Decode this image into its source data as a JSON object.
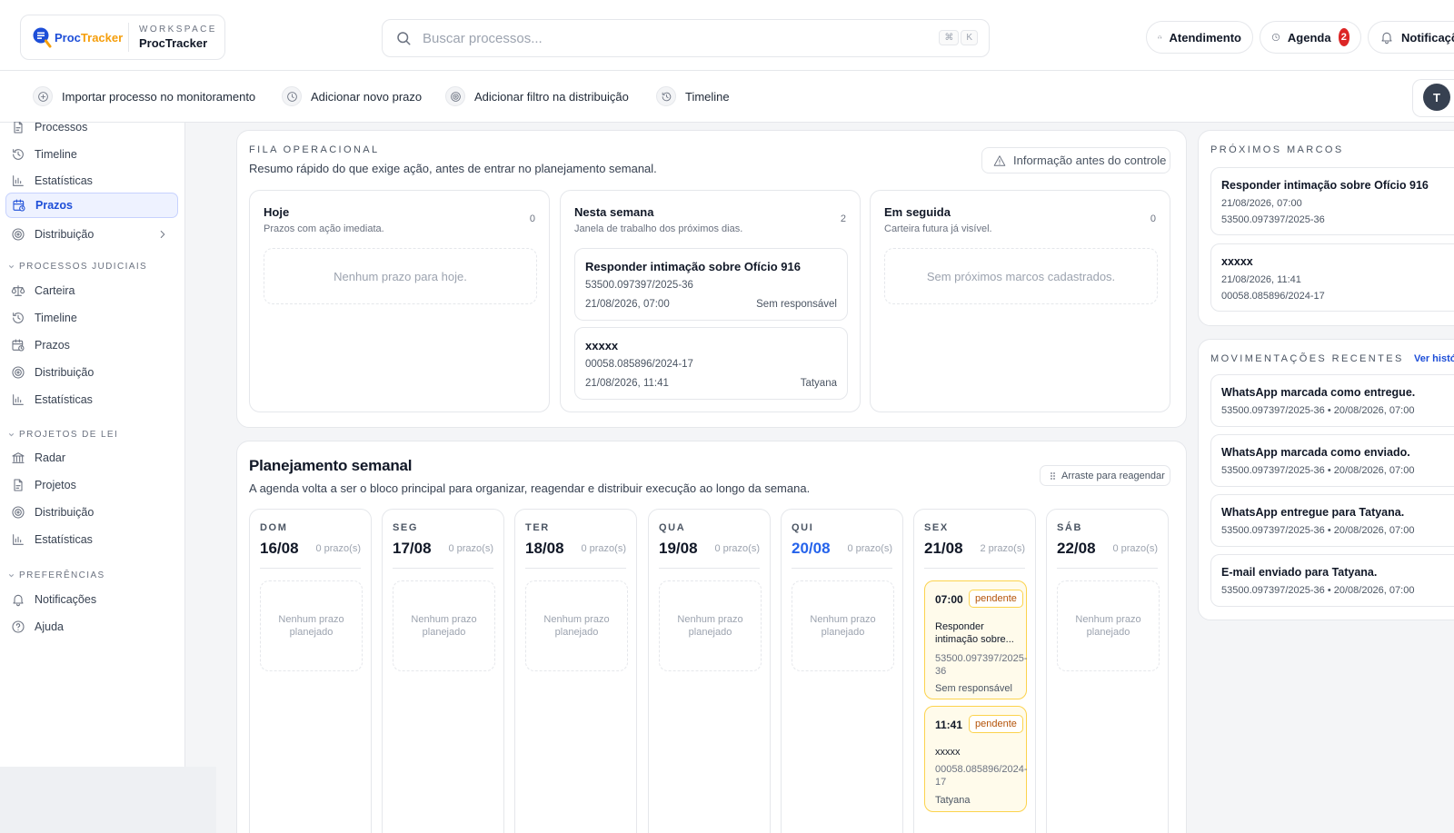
{
  "brand": {
    "logo_text_a": "Proc",
    "logo_text_b": "Tracker",
    "workspace_label": "WORKSPACE",
    "workspace_name": "ProcTracker"
  },
  "search": {
    "placeholder": "Buscar processos...",
    "shortcut_mod": "⌘",
    "shortcut_key": "K"
  },
  "header": {
    "atendimento_label": "Atendimento",
    "agenda_label": "Agenda",
    "agenda_badge": "2",
    "notificacoes_label": "Notificações",
    "avatar_initial": "T"
  },
  "quick_actions": [
    {
      "label": "Importar processo no monitoramento",
      "icon": "plus-circle-icon"
    },
    {
      "label": "Adicionar novo prazo",
      "icon": "clock-icon"
    },
    {
      "label": "Adicionar filtro na distribuição",
      "icon": "target-icon"
    },
    {
      "label": "Timeline",
      "icon": "history-icon"
    }
  ],
  "sidebar": {
    "top_items": [
      {
        "label": "Processos",
        "icon": "file-icon"
      },
      {
        "label": "Timeline",
        "icon": "history-icon"
      },
      {
        "label": "Estatísticas",
        "icon": "chart-icon"
      },
      {
        "label": "Prazos",
        "icon": "calendar-clock-icon",
        "active": true
      },
      {
        "label": "Distribuição",
        "icon": "target-icon"
      }
    ],
    "sections": [
      {
        "title": "PROCESSOS JUDICIAIS",
        "items": [
          {
            "label": "Carteira",
            "icon": "scale-icon"
          },
          {
            "label": "Timeline",
            "icon": "history-icon"
          },
          {
            "label": "Prazos",
            "icon": "calendar-clock-icon"
          },
          {
            "label": "Distribuição",
            "icon": "target-icon"
          },
          {
            "label": "Estatísticas",
            "icon": "chart-icon"
          }
        ]
      },
      {
        "title": "PROJETOS DE LEI",
        "items": [
          {
            "label": "Radar",
            "icon": "landmark-icon"
          },
          {
            "label": "Projetos",
            "icon": "file-icon"
          },
          {
            "label": "Distribuição",
            "icon": "target-icon"
          },
          {
            "label": "Estatísticas",
            "icon": "chart-icon"
          }
        ]
      },
      {
        "title": "PREFERÊNCIAS",
        "items": [
          {
            "label": "Notificações",
            "icon": "bell-icon"
          },
          {
            "label": "Ajuda",
            "icon": "help-icon"
          }
        ]
      }
    ]
  },
  "fila": {
    "eyebrow": "FILA OPERACIONAL",
    "subtitle": "Resumo rápido do que exige ação, antes de entrar no planejamento semanal.",
    "info_button": "Informação antes do controle",
    "columns": [
      {
        "title": "Hoje",
        "subtitle": "Prazos com ação imediata.",
        "count": "0",
        "empty": "Nenhum prazo para hoje.",
        "cards": []
      },
      {
        "title": "Nesta semana",
        "subtitle": "Janela de trabalho dos próximos dias.",
        "count": "2",
        "empty": "",
        "cards": [
          {
            "title": "Responder intimação sobre Ofício 916",
            "process": "53500.097397/2025-36",
            "date": "21/08/2026, 07:00",
            "owner": "Sem responsável"
          },
          {
            "title": "xxxxx",
            "process": "00058.085896/2024-17",
            "date": "21/08/2026, 11:41",
            "owner": "Tatyana"
          }
        ]
      },
      {
        "title": "Em seguida",
        "subtitle": "Carteira futura já visível.",
        "count": "0",
        "empty": "Sem próximos marcos cadastrados.",
        "cards": []
      }
    ]
  },
  "planning": {
    "title": "Planejamento semanal",
    "subtitle": "A agenda volta a ser o bloco principal para organizar, reagendar e distribuir execução ao longo da semana.",
    "drag_hint": "Arraste para reagendar",
    "empty_text": "Nenhum prazo planejado",
    "days": [
      {
        "name": "DOM",
        "date": "16/08",
        "count": "0 prazo(s)"
      },
      {
        "name": "SEG",
        "date": "17/08",
        "count": "0 prazo(s)"
      },
      {
        "name": "TER",
        "date": "18/08",
        "count": "0 prazo(s)"
      },
      {
        "name": "QUA",
        "date": "19/08",
        "count": "0 prazo(s)"
      },
      {
        "name": "QUI",
        "date": "20/08",
        "count": "0 prazo(s)",
        "today": true
      },
      {
        "name": "SEX",
        "date": "21/08",
        "count": "2 prazo(s)",
        "events": [
          {
            "time": "07:00",
            "status": "pendente",
            "title": "Responder intimação sobre...",
            "process": "53500.097397/2025-36",
            "owner": "Sem responsável"
          },
          {
            "time": "11:41",
            "status": "pendente",
            "title": "xxxxx",
            "process": "00058.085896/2024-17",
            "owner": "Tatyana"
          }
        ]
      },
      {
        "name": "SÁB",
        "date": "22/08",
        "count": "0 prazo(s)"
      }
    ]
  },
  "marcos": {
    "eyebrow": "PRÓXIMOS MARCOS",
    "items": [
      {
        "title": "Responder intimação sobre Ofício 916",
        "date": "21/08/2026, 07:00",
        "process": "53500.097397/2025-36"
      },
      {
        "title": "xxxxx",
        "date": "21/08/2026, 11:41",
        "process": "00058.085896/2024-17"
      }
    ]
  },
  "movimentacoes": {
    "eyebrow": "MOVIMENTAÇÕES RECENTES",
    "link": "Ver histórico",
    "items": [
      {
        "title": "WhatsApp marcada como entregue.",
        "meta": "53500.097397/2025-36 • 20/08/2026, 07:00"
      },
      {
        "title": "WhatsApp marcada como enviado.",
        "meta": "53500.097397/2025-36 • 20/08/2026, 07:00"
      },
      {
        "title": "WhatsApp entregue para Tatyana.",
        "meta": "53500.097397/2025-36 • 20/08/2026, 07:00"
      },
      {
        "title": "E-mail enviado para Tatyana.",
        "meta": "53500.097397/2025-36 • 20/08/2026, 07:00"
      }
    ]
  },
  "colors": {
    "accent": "#2563eb",
    "brand_orange": "#f59e0b",
    "badge_red": "#dc2626",
    "pending_bg": "#fffbeb",
    "pending_border": "#fcd34d"
  }
}
